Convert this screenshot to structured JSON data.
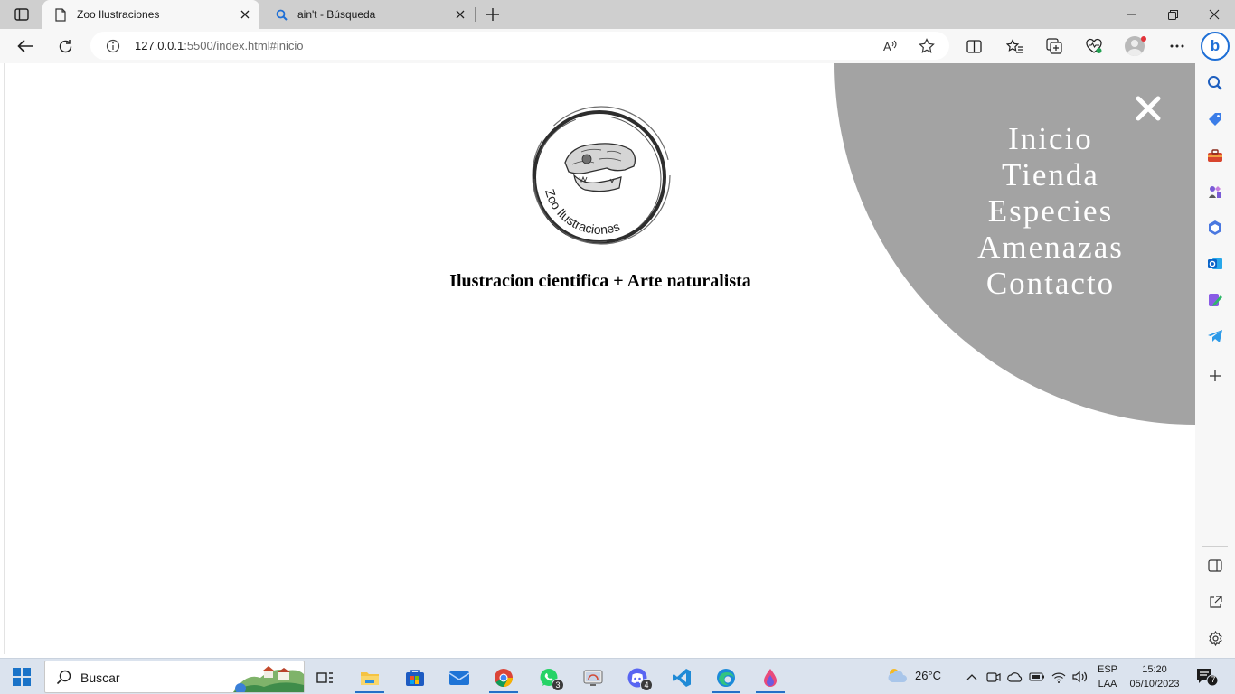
{
  "browser": {
    "tabs": [
      {
        "title": "Zoo Ilustraciones",
        "active": true,
        "icon": "page-icon"
      },
      {
        "title": "ain't - Búsqueda",
        "active": false,
        "icon": "search-icon"
      }
    ],
    "address": {
      "host": "127.0.0.1",
      "rest": ":5500/index.html#inicio"
    },
    "accent": "#1e6fd6"
  },
  "page": {
    "logo_text": "Zoo Ilustraciones",
    "tagline": "Ilustracion cientifica + Arte naturalista",
    "menu_color": "#a3a3a3",
    "menu": [
      "Inicio",
      "Tienda",
      "Especies",
      "Amenazas",
      "Contacto"
    ]
  },
  "sidebar": {
    "items": [
      "search-icon",
      "shopping-tag-icon",
      "toolbox-icon",
      "games-icon",
      "office-icon",
      "outlook-icon",
      "designer-icon",
      "telegram-icon",
      "add-icon"
    ],
    "bottom": [
      "split-pane-icon",
      "external-link-icon",
      "settings-icon"
    ]
  },
  "taskbar": {
    "search_placeholder": "Buscar",
    "whatsapp_badge": "3",
    "discord_badge": "4",
    "weather": "26°C",
    "lang_top": "ESP",
    "lang_bottom": "LAA",
    "time": "15:20",
    "date": "05/10/2023",
    "notifications": "7"
  }
}
